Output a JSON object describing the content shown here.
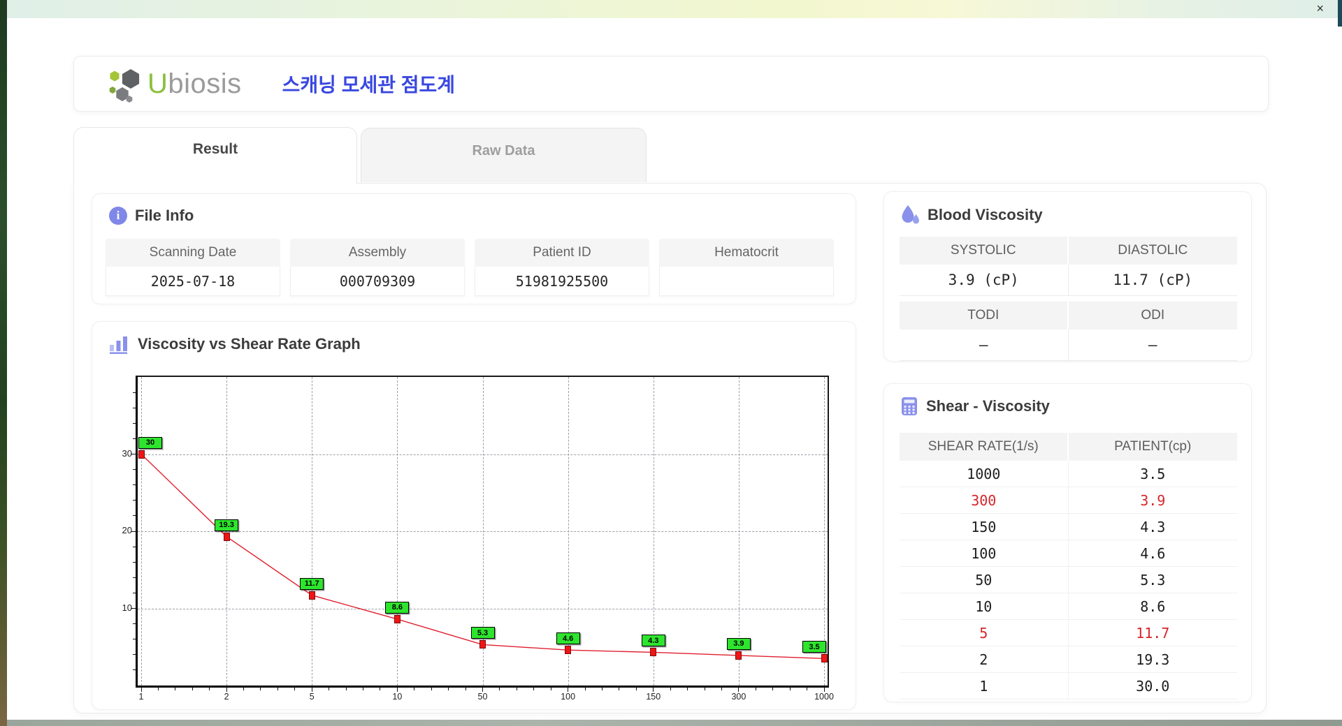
{
  "window": {
    "close_label": "×"
  },
  "header": {
    "logo_u": "U",
    "logo_rest": "biosis",
    "title": "스캐닝 모세관 점도계"
  },
  "tabs": [
    {
      "label": "Result",
      "active": true
    },
    {
      "label": "Raw Data",
      "active": false
    }
  ],
  "file_info": {
    "section_title": "File Info",
    "fields": [
      {
        "label": "Scanning Date",
        "value": "2025-07-18"
      },
      {
        "label": "Assembly",
        "value": "000709309"
      },
      {
        "label": "Patient ID",
        "value": "51981925500"
      },
      {
        "label": "Hematocrit",
        "value": ""
      }
    ]
  },
  "blood_viscosity": {
    "section_title": "Blood Viscosity",
    "rows": [
      {
        "labels": [
          "SYSTOLIC",
          "DIASTOLIC"
        ],
        "values": [
          "3.9 (cP)",
          "11.7 (cP)"
        ]
      },
      {
        "labels": [
          "TODI",
          "ODI"
        ],
        "values": [
          "–",
          "–"
        ]
      }
    ]
  },
  "graph": {
    "section_title": "Viscosity vs Shear Rate Graph"
  },
  "chart_data": {
    "type": "line",
    "title": "Viscosity vs Shear Rate Graph",
    "x_scale": "category",
    "x": [
      1,
      2,
      5,
      10,
      50,
      100,
      150,
      300,
      1000
    ],
    "x_tick_labels": [
      "1",
      "2",
      "5",
      "10",
      "50",
      "100",
      "150",
      "300",
      "1000"
    ],
    "series": [
      {
        "name": "PATIENT(cp)",
        "values": [
          30,
          19.3,
          11.7,
          8.6,
          5.3,
          4.6,
          4.3,
          3.9,
          3.5
        ]
      }
    ],
    "point_labels": [
      "30",
      "19.3",
      "11.7",
      "8.6",
      "5.3",
      "4.6",
      "4.3",
      "3.9",
      "3.5"
    ],
    "ylim": [
      0,
      40
    ],
    "y_ticks": [
      10,
      20,
      30
    ],
    "grid": "dashed",
    "legend": "none",
    "line_color": "#e02030",
    "marker_color": "#f01515",
    "marker_border": "#7d0c0c",
    "label_bg": "#2de52d",
    "label_border": "#000000"
  },
  "shear_viscosity": {
    "section_title": "Shear - Viscosity",
    "columns": [
      "SHEAR RATE(1/s)",
      "PATIENT(cp)"
    ],
    "rows": [
      {
        "shear": "1000",
        "patient": "3.5",
        "highlight": false
      },
      {
        "shear": "300",
        "patient": "3.9",
        "highlight": true
      },
      {
        "shear": "150",
        "patient": "4.3",
        "highlight": false
      },
      {
        "shear": "100",
        "patient": "4.6",
        "highlight": false
      },
      {
        "shear": "50",
        "patient": "5.3",
        "highlight": false
      },
      {
        "shear": "10",
        "patient": "8.6",
        "highlight": false
      },
      {
        "shear": "5",
        "patient": "11.7",
        "highlight": true
      },
      {
        "shear": "2",
        "patient": "19.3",
        "highlight": false
      },
      {
        "shear": "1",
        "patient": "30.0",
        "highlight": false
      }
    ]
  }
}
